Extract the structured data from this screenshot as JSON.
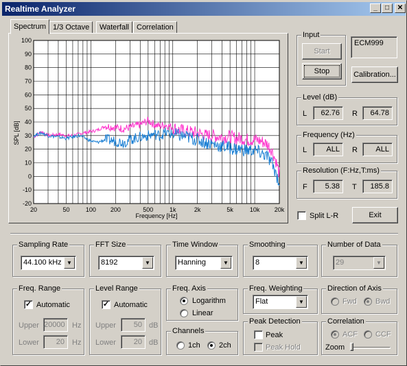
{
  "window": {
    "title": "Realtime Analyzer",
    "minimize": "_",
    "maximize": "□",
    "close": "✕"
  },
  "tabs": [
    {
      "label": "Spectrum"
    },
    {
      "label": "1/3 Octave"
    },
    {
      "label": "Waterfall"
    },
    {
      "label": "Correlation"
    }
  ],
  "chart_data": {
    "type": "line",
    "xlabel": "Frequency  [Hz]",
    "ylabel": "SPL [dB]",
    "xscale": "log",
    "xlim": [
      20,
      20000
    ],
    "ylim": [
      -20,
      100
    ],
    "xticks": [
      "20",
      "50",
      "100",
      "200",
      "500",
      "1k",
      "2k",
      "5k",
      "10k",
      "20k"
    ],
    "yticks": [
      "100",
      "90",
      "80",
      "70",
      "60",
      "50",
      "40",
      "30",
      "20",
      "10",
      "0",
      "-10",
      "-20"
    ],
    "grid": true,
    "series": [
      {
        "color": "#ff33cc",
        "x": [
          20,
          25,
          30,
          40,
          50,
          60,
          70,
          80,
          100,
          120,
          150,
          200,
          250,
          300,
          400,
          500,
          600,
          700,
          800,
          1000,
          1200,
          1500,
          2000,
          2500,
          3000,
          4000,
          5000,
          6000,
          7000,
          8000,
          10000,
          12000,
          14000,
          16000,
          18000,
          20000
        ],
        "y": [
          29,
          33,
          30,
          31,
          30,
          30,
          31,
          32,
          33,
          34,
          37,
          36,
          35,
          36,
          38,
          41,
          38,
          37,
          38,
          36,
          34,
          33,
          32,
          30,
          30,
          29,
          29,
          28,
          28,
          27,
          27,
          26,
          24,
          20,
          12,
          2
        ]
      },
      {
        "color": "#1a7fd4",
        "x": [
          20,
          25,
          30,
          40,
          50,
          60,
          70,
          80,
          100,
          120,
          150,
          200,
          250,
          300,
          400,
          500,
          600,
          700,
          800,
          1000,
          1200,
          1500,
          2000,
          2500,
          3000,
          4000,
          5000,
          6000,
          7000,
          8000,
          10000,
          12000,
          14000,
          16000,
          18000,
          20000
        ],
        "y": [
          30,
          32,
          30,
          29,
          28,
          29,
          30,
          29,
          26,
          25,
          27,
          26,
          25,
          27,
          29,
          30,
          31,
          30,
          32,
          31,
          30,
          29,
          27,
          25,
          24,
          22,
          21,
          20,
          20,
          19,
          19,
          17,
          15,
          10,
          3,
          -5
        ]
      }
    ]
  },
  "input": {
    "legend": "Input",
    "start": "Start",
    "stop": "Stop",
    "device": "ECM999",
    "calibration": "Calibration..."
  },
  "level": {
    "legend": "Level (dB)",
    "l_label": "L",
    "l_value": "62.76",
    "r_label": "R",
    "r_value": "64.78"
  },
  "frequency": {
    "legend": "Frequency (Hz)",
    "l_label": "L",
    "l_value": "ALL",
    "r_label": "R",
    "r_value": "ALL"
  },
  "resolution": {
    "legend": "Resolution (F:Hz,T:ms)",
    "f_label": "F",
    "f_value": "5.38",
    "t_label": "T",
    "t_value": "185.8"
  },
  "split": {
    "label": "Split L-R",
    "checked": false
  },
  "exit": "Exit",
  "sampling_rate": {
    "legend": "Sampling Rate",
    "value": "44.100 kHz"
  },
  "fft_size": {
    "legend": "FFT Size",
    "value": "8192"
  },
  "time_window": {
    "legend": "Time Window",
    "value": "Hanning"
  },
  "smoothing": {
    "legend": "Smoothing",
    "value": "8"
  },
  "number_of_data": {
    "legend": "Number of Data",
    "value": "29"
  },
  "freq_range": {
    "legend": "Freq. Range",
    "automatic": "Automatic",
    "upper_label": "Upper",
    "upper_value": "20000",
    "upper_unit": "Hz",
    "lower_label": "Lower",
    "lower_value": "20",
    "lower_unit": "Hz"
  },
  "level_range": {
    "legend": "Level Range",
    "automatic": "Automatic",
    "upper_label": "Upper",
    "upper_value": "50",
    "upper_unit": "dB",
    "lower_label": "Lower",
    "lower_value": "20",
    "lower_unit": "dB"
  },
  "freq_axis": {
    "legend": "Freq. Axis",
    "logarithm": "Logarithm",
    "linear": "Linear"
  },
  "channels": {
    "legend": "Channels",
    "ch1": "1ch",
    "ch2": "2ch"
  },
  "freq_weighting": {
    "legend": "Freq. Weighting",
    "value": "Flat"
  },
  "peak_detection": {
    "legend": "Peak Detection",
    "peak": "Peak",
    "peak_hold": "Peak Hold"
  },
  "direction_of_axis": {
    "legend": "Direction of Axis",
    "fwd": "Fwd",
    "bwd": "Bwd"
  },
  "correlation": {
    "legend": "Correlation",
    "acf": "ACF",
    "ccf": "CCF",
    "zoom": "Zoom"
  }
}
